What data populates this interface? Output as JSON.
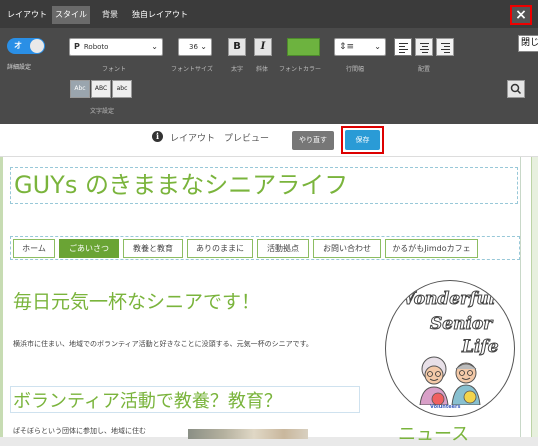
{
  "editor": {
    "tabs": [
      {
        "label": "レイアウト",
        "active": false
      },
      {
        "label": "スタイル",
        "active": true
      },
      {
        "label": "背景",
        "active": false
      },
      {
        "label": "独自レイアウト",
        "active": false
      }
    ],
    "close_label": "×",
    "tooltip": "閉じる",
    "toggle": {
      "label": "オ",
      "caption": "詳細設定",
      "on": true
    },
    "font": {
      "value": "Roboto",
      "label": "フォント"
    },
    "font_size": {
      "value": "36",
      "label": "フォントサイズ"
    },
    "bold": {
      "glyph": "B",
      "label": "太字"
    },
    "italic": {
      "glyph": "I",
      "label": "斜体"
    },
    "font_color": {
      "label": "フォントカラー",
      "color": "#6db33f"
    },
    "line_spacing": {
      "label": "行間幅"
    },
    "alignment": {
      "label": "配置",
      "selected": "left"
    },
    "text_case": {
      "options": [
        "Abc",
        "ABC",
        "abc"
      ],
      "selected": "Abc",
      "label": "文字設定"
    }
  },
  "preview": {
    "info_glyph": "i",
    "text": "レイアウト　プレビュー",
    "redo_label": "やり直す",
    "save_label": "保存"
  },
  "site": {
    "title": "GUYs のきままなシニアライフ",
    "nav": [
      "ホーム",
      "ごあいさつ",
      "教養と教育",
      "ありのままに",
      "活動拠点",
      "お問い合わせ",
      "かるがもJimdoカフェ"
    ],
    "nav_active": "ごあいさつ",
    "heading1": "毎日元気一杯なシニアです！",
    "paragraph": "横浜市に住まい、地域でのボランティア活動と好きなことに没頭する、元気一杯のシニアです。",
    "heading2": "ボランティア活動で教養？教育？",
    "paragraph2": "ぱそぼらという団体に参加し、地域に住む",
    "news": "ニュース",
    "logo": {
      "line1": "Wonderful",
      "line2": "Senior",
      "line3": "Life",
      "badge": "Volunteers"
    }
  }
}
